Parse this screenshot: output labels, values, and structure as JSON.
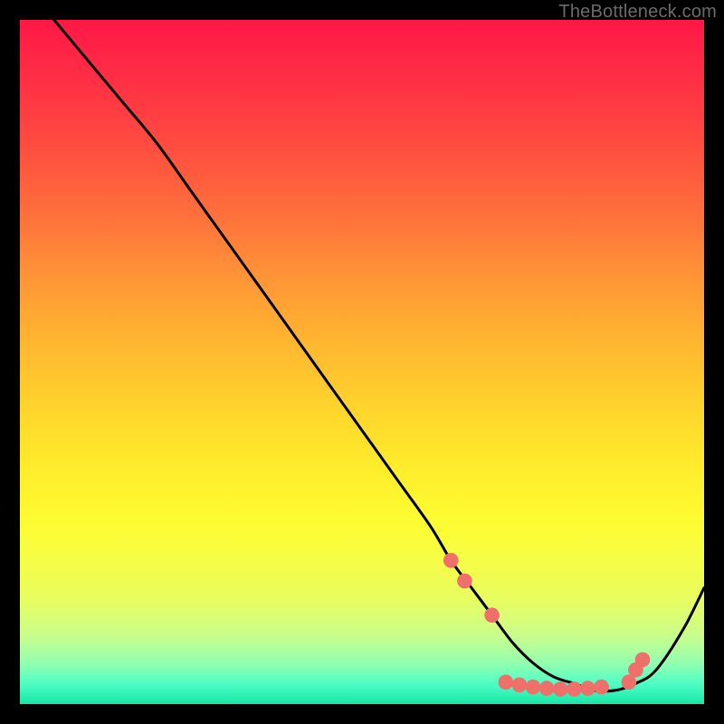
{
  "watermark": "TheBottleneck.com",
  "chart_data": {
    "type": "line",
    "title": "",
    "xlabel": "",
    "ylabel": "",
    "xlim": [
      0,
      100
    ],
    "ylim": [
      0,
      100
    ],
    "grid": false,
    "legend": false,
    "series": [
      {
        "name": "bottleneck-curve",
        "x": [
          5,
          10,
          15,
          20,
          25,
          30,
          35,
          40,
          45,
          50,
          55,
          60,
          63,
          66,
          69,
          72,
          75,
          78,
          81,
          84,
          87,
          90,
          93,
          97,
          100
        ],
        "y": [
          100,
          94,
          88,
          82,
          75,
          68,
          61,
          54,
          47,
          40,
          33,
          26,
          21,
          17,
          13,
          9,
          6,
          4,
          3,
          2,
          2,
          3,
          5,
          11,
          17
        ]
      }
    ],
    "markers": {
      "name": "highlight-dots",
      "color": "#ef6f6a",
      "radius_pct": 1.1,
      "points_x": [
        63,
        65,
        69,
        71,
        73,
        75,
        77,
        79,
        81,
        83,
        85,
        89,
        90,
        91
      ],
      "points_y": [
        21,
        18,
        13,
        3.2,
        2.8,
        2.5,
        2.3,
        2.2,
        2.2,
        2.3,
        2.5,
        3.2,
        5,
        6.5
      ]
    },
    "background": {
      "type": "vertical-gradient",
      "stops": [
        {
          "pct": 0,
          "color": "#ff1846"
        },
        {
          "pct": 50,
          "color": "#ffd22e"
        },
        {
          "pct": 80,
          "color": "#f6fd44"
        },
        {
          "pct": 100,
          "color": "#18e6a7"
        }
      ]
    }
  }
}
